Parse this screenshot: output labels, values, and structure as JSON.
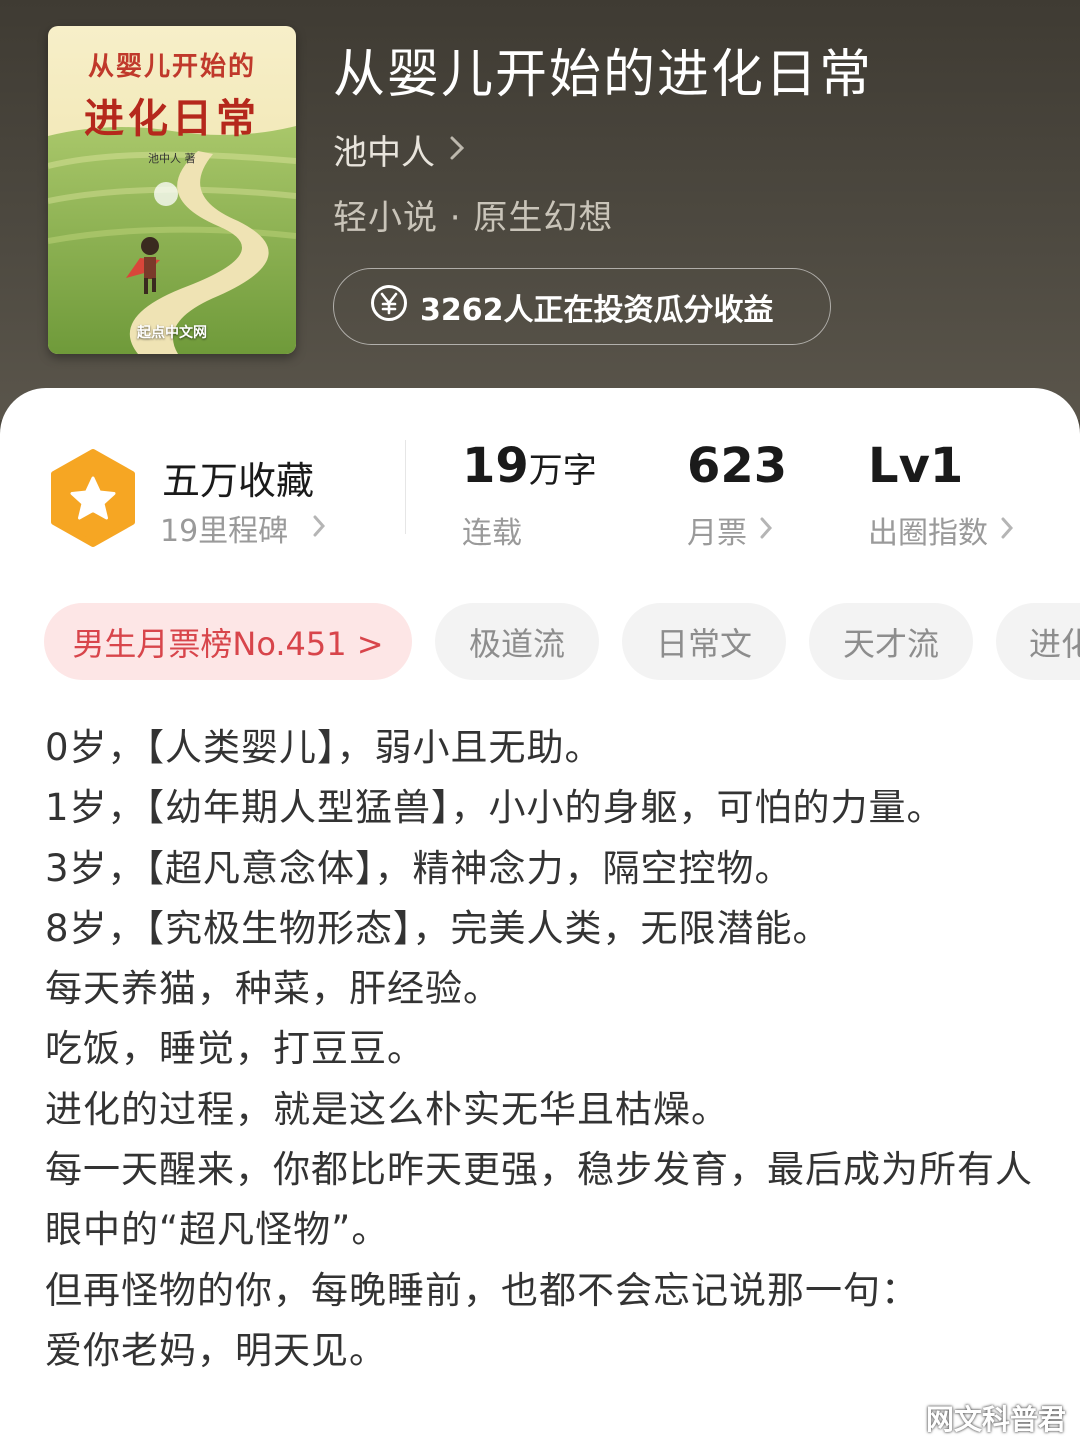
{
  "book": {
    "title": "从婴儿开始的进化日常",
    "author": "池中人",
    "genre": "轻小说 · 原生幻想",
    "invest_text": "3262人正在投资瓜分收益",
    "cover": {
      "title_line1": "从婴儿开始的",
      "title_line2": "进化日常",
      "author_mark": "池中人 著",
      "publisher": "起点中文网"
    }
  },
  "stats": {
    "favorites_label": "五万收藏",
    "milestone_label": "19里程碑",
    "word_count": "19",
    "word_unit": "万字",
    "status": "连载",
    "monthly_votes": "623",
    "monthly_votes_label": "月票",
    "level": "Lv1",
    "level_label": "出圈指数"
  },
  "tags": [
    "男生月票榜No.451 >",
    "极道流",
    "日常文",
    "天才流",
    "进化"
  ],
  "description": "0岁，【人类婴儿】，弱小且无助。\n1岁，【幼年期人型猛兽】，小小的身躯，可怕的力量。\n3岁，【超凡意念体】，精神念力，隔空控物。\n8岁，【究极生物形态】，完美人类，无限潜能。\n每天养猫，种菜，肝经验。\n吃饭，睡觉，打豆豆。\n进化的过程，就是这么朴实无华且枯燥。\n每一天醒来，你都比昨天更强，稳步发育，最后成为所有人眼中的“超凡怪物”。\n但再怪物的你，每晚睡前，也都不会忘记说那一句：\n爱你老妈，明天见。",
  "watermark": "网文科普君",
  "colors": {
    "header_bg": "#4a463d",
    "rank_tag_bg": "#fde6e6",
    "rank_tag_text": "#d8454b",
    "badge_orange": "#f6a623"
  }
}
